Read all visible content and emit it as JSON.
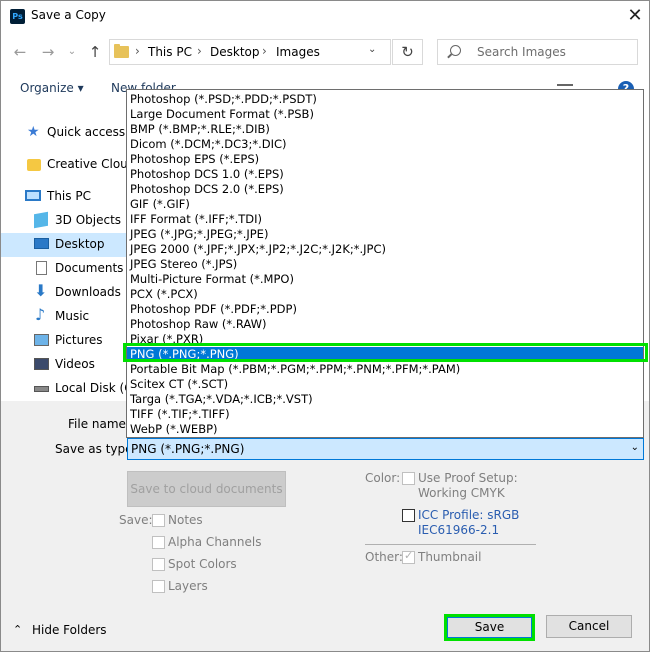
{
  "window": {
    "title": "Save a Copy",
    "app_icon": "Ps"
  },
  "address": {
    "crumbs": [
      "This PC",
      "Desktop",
      "Images"
    ],
    "search_placeholder": "Search Images"
  },
  "toolbar": {
    "organize": "Organize ▾",
    "new_folder": "New folder",
    "help": "?"
  },
  "nav_pane": [
    {
      "label": "Quick access",
      "icon": "star-icon"
    },
    {
      "label": "Creative Cloud",
      "icon": "creative-cloud-icon"
    },
    {
      "label": "This PC",
      "icon": "computer-icon"
    },
    {
      "label": "3D Objects",
      "icon": "cube-icon"
    },
    {
      "label": "Desktop",
      "icon": "desktop-icon",
      "selected": true
    },
    {
      "label": "Documents",
      "icon": "document-icon"
    },
    {
      "label": "Downloads",
      "icon": "download-icon"
    },
    {
      "label": "Music",
      "icon": "music-icon"
    },
    {
      "label": "Pictures",
      "icon": "picture-icon"
    },
    {
      "label": "Videos",
      "icon": "video-icon"
    },
    {
      "label": "Local Disk (C:",
      "icon": "drive-icon"
    }
  ],
  "form": {
    "file_name_label": "File name:",
    "save_as_type_label": "Save as type:",
    "save_as_type_value": "PNG (*.PNG;*.PNG)"
  },
  "file_types": [
    "Photoshop (*.PSD;*.PDD;*.PSDT)",
    "Large Document Format (*.PSB)",
    "BMP (*.BMP;*.RLE;*.DIB)",
    "Dicom (*.DCM;*.DC3;*.DIC)",
    "Photoshop EPS (*.EPS)",
    "Photoshop DCS 1.0 (*.EPS)",
    "Photoshop DCS 2.0 (*.EPS)",
    "GIF (*.GIF)",
    "IFF Format (*.IFF;*.TDI)",
    "JPEG (*.JPG;*.JPEG;*.JPE)",
    "JPEG 2000 (*.JPF;*.JPX;*.JP2;*.J2C;*.J2K;*.JPC)",
    "JPEG Stereo (*.JPS)",
    "Multi-Picture Format (*.MPO)",
    "PCX (*.PCX)",
    "Photoshop PDF (*.PDF;*.PDP)",
    "Photoshop Raw (*.RAW)",
    "Pixar (*.PXR)",
    "PNG (*.PNG;*.PNG)",
    "Portable Bit Map (*.PBM;*.PGM;*.PPM;*.PNM;*.PFM;*.PAM)",
    "Scitex CT (*.SCT)",
    "Targa (*.TGA;*.VDA;*.ICB;*.VST)",
    "TIFF (*.TIF;*.TIFF)",
    "WebP (*.WEBP)"
  ],
  "selected_file_type": "PNG (*.PNG;*.PNG)",
  "options": {
    "save_to_cloud": "Save to cloud documents",
    "save_label": "Save:",
    "notes": "Notes",
    "alpha_channels": "Alpha Channels",
    "spot_colors": "Spot Colors",
    "layers": "Layers",
    "color_label": "Color:",
    "use_proof_setup": "Use Proof Setup:",
    "working_cmyk": "Working CMYK",
    "icc_profile": "ICC Profile:  sRGB",
    "icc_profile_2": "IEC61966-2.1",
    "other_label": "Other:",
    "thumbnail": "Thumbnail"
  },
  "footer": {
    "hide_folders": "Hide Folders",
    "save": "Save",
    "cancel": "Cancel"
  }
}
